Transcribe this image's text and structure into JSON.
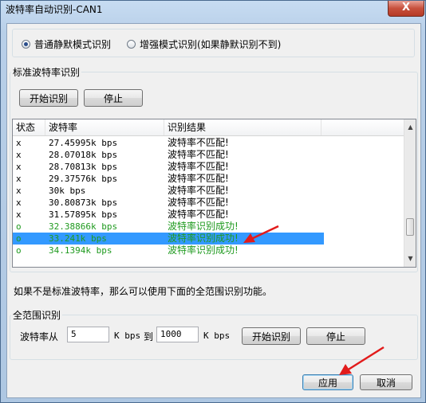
{
  "window": {
    "title": "波特率自动识别-CAN1",
    "close_symbol": "X"
  },
  "mode": {
    "normal_label": "普通静默模式识别",
    "enhanced_label": "增强模式识别(如果静默识别不到)",
    "selected": "normal"
  },
  "standard": {
    "group_label": "标准波特率识别",
    "start_label": "开始识别",
    "stop_label": "停止",
    "columns": [
      "状态",
      "波特率",
      "识别结果"
    ],
    "rows": [
      {
        "status": "x",
        "baud": "27.45995k bps",
        "result": "波特率不匹配!",
        "ok": false,
        "selected": false
      },
      {
        "status": "x",
        "baud": "28.07018k bps",
        "result": "波特率不匹配!",
        "ok": false,
        "selected": false
      },
      {
        "status": "x",
        "baud": "28.70813k bps",
        "result": "波特率不匹配!",
        "ok": false,
        "selected": false
      },
      {
        "status": "x",
        "baud": "29.37576k bps",
        "result": "波特率不匹配!",
        "ok": false,
        "selected": false
      },
      {
        "status": "x",
        "baud": "30k bps",
        "result": "波特率不匹配!",
        "ok": false,
        "selected": false
      },
      {
        "status": "x",
        "baud": "30.80873k bps",
        "result": "波特率不匹配!",
        "ok": false,
        "selected": false
      },
      {
        "status": "x",
        "baud": "31.57895k bps",
        "result": "波特率不匹配!",
        "ok": false,
        "selected": false
      },
      {
        "status": "o",
        "baud": "32.38866k bps",
        "result": "波特率识别成功!",
        "ok": true,
        "selected": false
      },
      {
        "status": "o",
        "baud": "33.241k bps",
        "result": "波特率识别成功!",
        "ok": true,
        "selected": true
      },
      {
        "status": "o",
        "baud": "34.1394k bps",
        "result": "波特率识别成功!",
        "ok": true,
        "selected": false
      }
    ],
    "scroll_up_symbol": "▲",
    "scroll_down_symbol": "▼"
  },
  "note": "如果不是标准波特率，那么可以使用下面的全范围识别功能。",
  "full_range": {
    "group_label": "全范围识别",
    "from_label": "波特率从",
    "from_value": "5",
    "unit1": "K bps",
    "to_label": "到",
    "to_value": "1000",
    "unit2": "K bps",
    "start_label": "开始识别",
    "stop_label": "停止"
  },
  "footer": {
    "apply_label": "应用",
    "cancel_label": "取消"
  },
  "colors": {
    "success": "#1f9a1f",
    "selection": "#3399ff",
    "arrow": "#e21b1b"
  }
}
